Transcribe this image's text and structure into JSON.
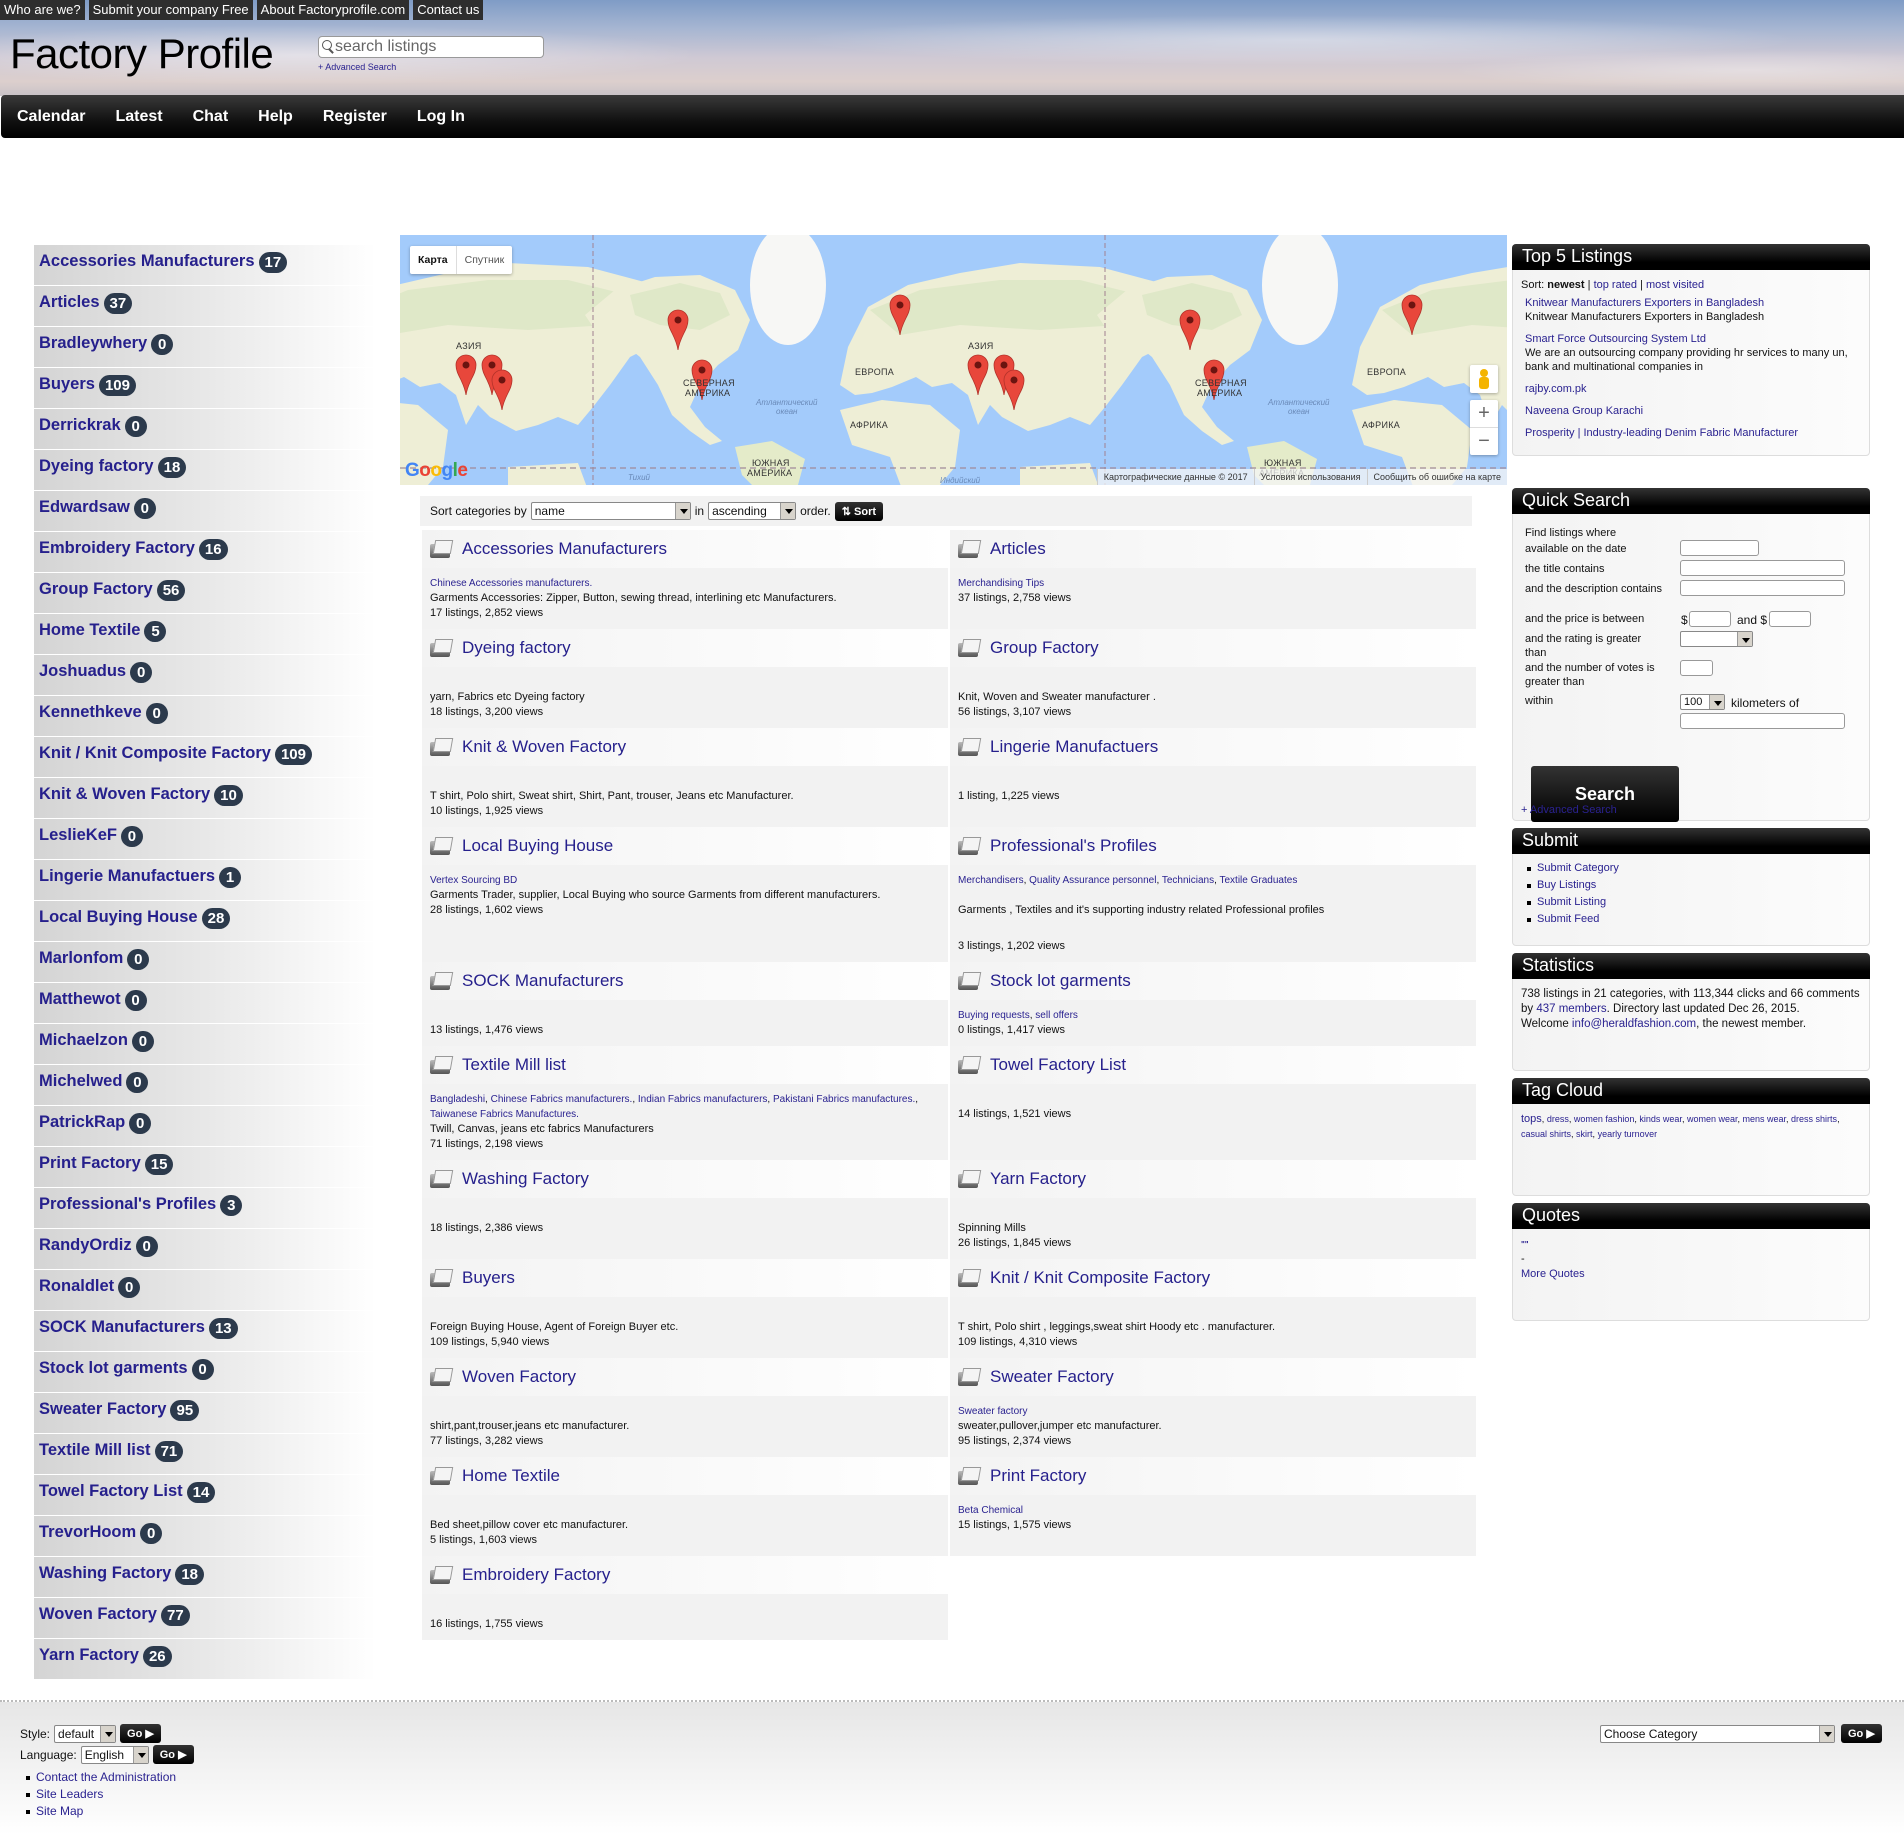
{
  "top_links": [
    "Who are we?",
    "Submit your company Free",
    "About Factoryprofile.com",
    "Contact us"
  ],
  "site_title": "Factory Profile",
  "search": {
    "placeholder": "search listings",
    "advanced": "+ Advanced Search"
  },
  "nav": [
    "Calendar",
    "Latest",
    "Chat",
    "Help",
    "Register",
    "Log In"
  ],
  "sidebar": [
    {
      "name": "Accessories Manufacturers",
      "count": "17"
    },
    {
      "name": "Articles",
      "count": "37"
    },
    {
      "name": "Bradleywhery",
      "count": "0"
    },
    {
      "name": "Buyers",
      "count": "109"
    },
    {
      "name": "Derrickrak",
      "count": "0"
    },
    {
      "name": "Dyeing factory",
      "count": "18"
    },
    {
      "name": "Edwardsaw",
      "count": "0"
    },
    {
      "name": "Embroidery Factory",
      "count": "16"
    },
    {
      "name": "Group Factory",
      "count": "56"
    },
    {
      "name": "Home Textile",
      "count": "5"
    },
    {
      "name": "Joshuadus",
      "count": "0"
    },
    {
      "name": "Kennethkeve",
      "count": "0"
    },
    {
      "name": "Knit / Knit Composite Factory",
      "count": "109"
    },
    {
      "name": "Knit & Woven Factory",
      "count": "10"
    },
    {
      "name": "LeslieKeF",
      "count": "0"
    },
    {
      "name": "Lingerie Manufactuers",
      "count": "1"
    },
    {
      "name": "Local Buying House",
      "count": "28"
    },
    {
      "name": "Marlonfom",
      "count": "0"
    },
    {
      "name": "Matthewot",
      "count": "0"
    },
    {
      "name": "Michaelzon",
      "count": "0"
    },
    {
      "name": "Michelwed",
      "count": "0"
    },
    {
      "name": "PatrickRap",
      "count": "0"
    },
    {
      "name": "Print Factory",
      "count": "15"
    },
    {
      "name": "Professional's Profiles",
      "count": "3"
    },
    {
      "name": "RandyOrdiz",
      "count": "0"
    },
    {
      "name": "Ronaldlet",
      "count": "0"
    },
    {
      "name": "SOCK Manufacturers",
      "count": "13"
    },
    {
      "name": "Stock lot garments",
      "count": "0"
    },
    {
      "name": "Sweater Factory",
      "count": "95"
    },
    {
      "name": "Textile Mill list",
      "count": "71"
    },
    {
      "name": "Towel Factory List",
      "count": "14"
    },
    {
      "name": "TrevorHoom",
      "count": "0"
    },
    {
      "name": "Washing Factory",
      "count": "18"
    },
    {
      "name": "Woven Factory",
      "count": "77"
    },
    {
      "name": "Yarn Factory",
      "count": "26"
    }
  ],
  "map": {
    "tab_map": "Карта",
    "tab_satellite": "Спутник",
    "labels": {
      "asia": "АЗИЯ",
      "north_america_1": "СЕВЕРНАЯ",
      "north_america_2": "АМЕРИКА",
      "europe": "ЕВРОПА",
      "africa": "АФРИКА",
      "south_america_1": "ЮЖНАЯ",
      "south_america_2": "АМЕРИКА",
      "atlantic_1": "Атлантический",
      "atlantic_2": "океан",
      "pacific": "Тихий",
      "indian": "Индийский"
    },
    "google": "Google",
    "attribution": [
      "Картографические данные © 2017",
      "Условия использования",
      "Сообщить об ошибке на карте"
    ],
    "zoom_in": "+",
    "zoom_out": "−",
    "pin_color": "#e8473b"
  },
  "sort": {
    "label": "Sort categories by",
    "field": "name",
    "in": "in",
    "direction": "ascending",
    "order": "order.",
    "button": "⇅ Sort"
  },
  "categories": [
    {
      "title": "Accessories Manufacturers",
      "links": [
        "Chinese Accessories manufacturers."
      ],
      "desc": "Garments Accessories: Zipper, Button, sewing thread, interlining etc Manufacturers.",
      "stats": "17 listings, 2,852 views"
    },
    {
      "title": "Articles",
      "links": [
        "Merchandising Tips"
      ],
      "desc": "",
      "stats": "37 listings, 2,758 views"
    },
    {
      "title": "Dyeing factory",
      "links": [],
      "desc": "yarn, Fabrics etc Dyeing factory",
      "stats": "18 listings, 3,200 views"
    },
    {
      "title": "Group Factory",
      "links": [],
      "desc": "Knit, Woven and Sweater manufacturer .",
      "stats": "56 listings, 3,107 views"
    },
    {
      "title": "Knit & Woven Factory",
      "links": [],
      "desc": "T shirt, Polo shirt, Sweat shirt, Shirt, Pant, trouser, Jeans etc Manufacturer.",
      "stats": "10 listings, 1,925 views"
    },
    {
      "title": "Lingerie Manufactuers",
      "links": [],
      "desc": "",
      "stats": "1 listing, 1,225 views"
    },
    {
      "title": "Local Buying House",
      "links": [
        "Vertex Sourcing BD"
      ],
      "desc": "Garments Trader, supplier, Local Buying who source Garments from different manufacturers.",
      "stats": "28 listings, 1,602 views"
    },
    {
      "title": "Professional's Profiles",
      "links": [
        "Merchandisers",
        "Quality Assurance personnel",
        "Technicians",
        "Textile Graduates"
      ],
      "desc": "Garments , Textiles and it's supporting  industry  related Professional profiles",
      "stats": "3 listings, 1,202 views"
    },
    {
      "title": "SOCK Manufacturers",
      "links": [],
      "desc": "",
      "stats": "13 listings, 1,476 views"
    },
    {
      "title": "Stock lot garments",
      "links": [
        "Buying requests",
        "sell offers"
      ],
      "desc": "",
      "stats": "0 listings, 1,417 views"
    },
    {
      "title": "Textile Mill list",
      "links": [
        "Bangladeshi",
        "Chinese Fabrics manufacturers.",
        "Indian Fabrics manufacturers",
        "Pakistani Fabrics manufactures.",
        "Taiwanese Fabrics Manufactures."
      ],
      "desc": "Twill, Canvas, jeans etc fabrics Manufacturers",
      "stats": "71 listings, 2,198 views"
    },
    {
      "title": "Towel Factory List",
      "links": [],
      "desc": "",
      "stats": "14 listings, 1,521 views"
    },
    {
      "title": "Washing Factory",
      "links": [],
      "desc": "",
      "stats": "18 listings, 2,386 views"
    },
    {
      "title": "Yarn Factory",
      "links": [],
      "desc": "Spinning Mills",
      "stats": "26 listings, 1,845 views"
    },
    {
      "title": "Buyers",
      "links": [],
      "desc": "Foreign Buying House, Agent of Foreign Buyer etc.",
      "stats": "109 listings, 5,940 views"
    },
    {
      "title": "Knit / Knit Composite Factory",
      "links": [],
      "desc": "T shirt, Polo shirt , leggings,sweat shirt Hoody etc . manufacturer.",
      "stats": "109 listings, 4,310 views"
    },
    {
      "title": "Woven Factory",
      "links": [],
      "desc": "shirt,pant,trouser,jeans etc manufacturer.",
      "stats": "77 listings, 3,282 views"
    },
    {
      "title": "Sweater Factory",
      "links": [
        "Sweater factory"
      ],
      "desc": "sweater,pullover,jumper etc manufacturer.",
      "stats": "95 listings, 2,374 views"
    },
    {
      "title": "Home Textile",
      "links": [],
      "desc": "Bed sheet,pillow cover etc manufacturer.",
      "stats": "5 listings, 1,603 views"
    },
    {
      "title": "Print Factory",
      "links": [
        "Beta Chemical"
      ],
      "desc": "",
      "stats": "15 listings, 1,575 views"
    },
    {
      "title": "Embroidery Factory",
      "links": [],
      "desc": "",
      "stats": "16 listings, 1,755 views"
    }
  ],
  "top5": {
    "title": "Top 5 Listings",
    "sort_label": "Sort:",
    "sort_active": "newest",
    "sort_top_rated": "top rated",
    "sort_most_visited": "most visited",
    "items": [
      {
        "title": "Knitwear Manufacturers Exporters in Bangladesh",
        "desc": "Knitwear Manufacturers Exporters in Bangladesh"
      },
      {
        "title": "Smart Force Outsourcing System Ltd",
        "desc": "We are an outsourcing company providing hr services to many un, bank and multinational companies in"
      },
      {
        "title": "rajby.com.pk",
        "desc": ""
      },
      {
        "title": "Naveena Group Karachi",
        "desc": ""
      },
      {
        "title": "Prosperity | Industry-leading Denim Fabric Manufacturer",
        "desc": ""
      }
    ]
  },
  "quick_search": {
    "title": "Quick Search",
    "intro": "Find listings where",
    "date": "available on the date",
    "title_contains": "the title contains",
    "desc_contains": "and the description contains",
    "price": "and the price is between",
    "dollar1": "$",
    "and": "and $",
    "rating": "and the rating is greater than",
    "votes": "and the number of votes is greater than",
    "within": "within",
    "km_value": "100",
    "km_label": "kilometers of",
    "button": "Search",
    "advanced": "+ Advanced Search"
  },
  "submit": {
    "title": "Submit",
    "items": [
      "Submit Category",
      "Buy Listings",
      "Submit Listing",
      "Submit Feed"
    ]
  },
  "statistics": {
    "title": "Statistics",
    "text1": "738 listings in 21 categories, with 113,344 clicks and 66 comments by ",
    "members": "437 members",
    "text2": ". Directory last updated Dec 26, 2015.",
    "welcome": "Welcome ",
    "member": "info@heraldfashion.com",
    "text3": ", the newest member."
  },
  "tag_cloud": {
    "title": "Tag Cloud",
    "tags": [
      "tops",
      "dress",
      "women fashion",
      "kinds wear",
      "women wear",
      "mens wear",
      "dress shirts",
      "casual shirts",
      "skirt",
      "yearly turnover"
    ]
  },
  "quotes": {
    "title": "Quotes",
    "quote": "\"\"",
    "author": "-",
    "more": "More Quotes"
  },
  "footer": {
    "style_label": "Style:",
    "style_value": "default",
    "language_label": "Language:",
    "language_value": "English",
    "go": "Go ▶",
    "links": [
      "Contact the Administration",
      "Site Leaders",
      "Site Map"
    ],
    "category_select": "Choose Category"
  }
}
